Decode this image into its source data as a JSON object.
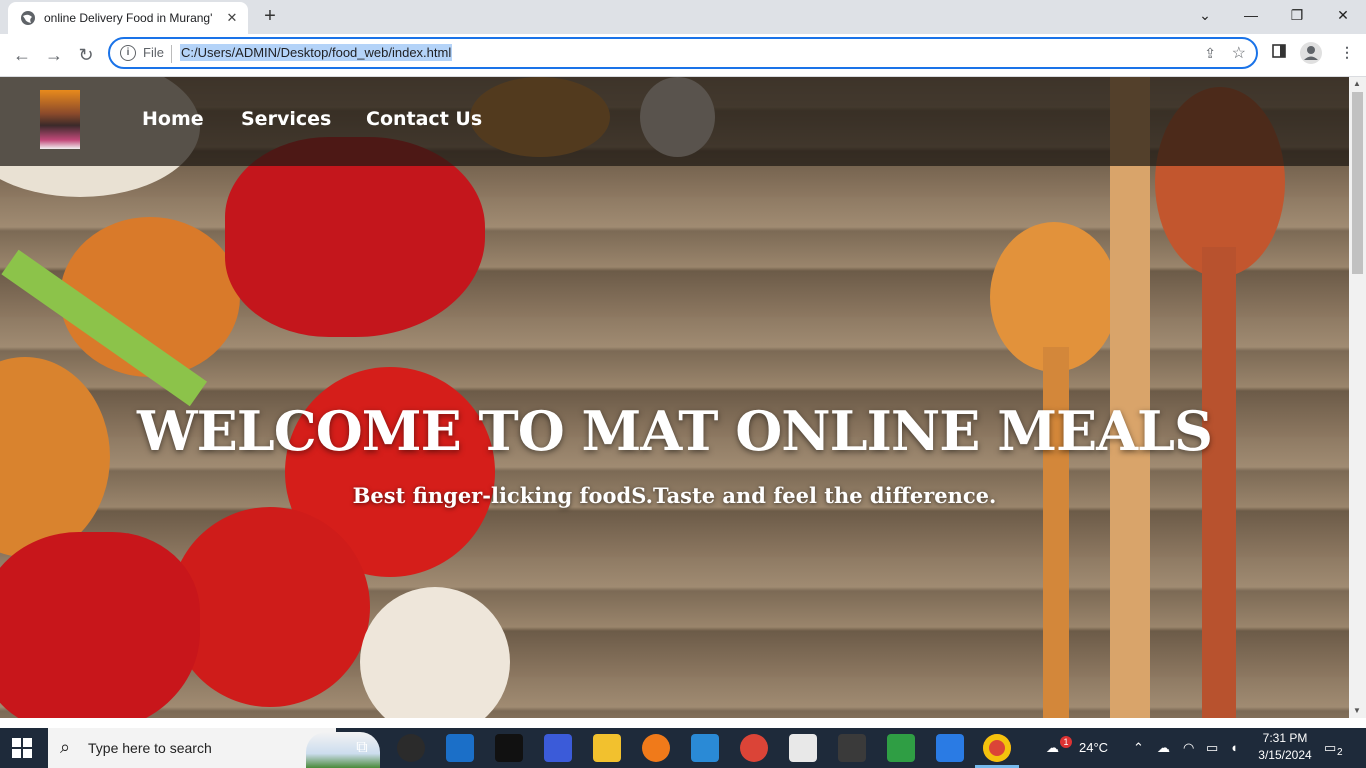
{
  "browser": {
    "tab_title": "online Delivery Food in Murang'",
    "tab_close": "✕",
    "new_tab": "+",
    "scheme": "File",
    "url": "C:/Users/ADMIN/Desktop/food_web/index.html",
    "window_controls": {
      "minimize": "—",
      "restore": "❐",
      "close": "✕"
    }
  },
  "site": {
    "nav": [
      {
        "label": "Home"
      },
      {
        "label": "Services"
      },
      {
        "label": "Contact Us"
      }
    ],
    "hero_title": "WELCOME TO MAT ONLINE MEALS",
    "hero_subtitle": "Best finger-licking foodS.Taste and feel the difference."
  },
  "taskbar": {
    "search_placeholder": "Type here to search",
    "weather": "24°C",
    "weather_badge": "1",
    "time": "7:31 PM",
    "date": "3/15/2024",
    "notifications": "2"
  },
  "colors": {
    "accent": "#1a73e8",
    "taskbar": "#1e2a3a"
  }
}
